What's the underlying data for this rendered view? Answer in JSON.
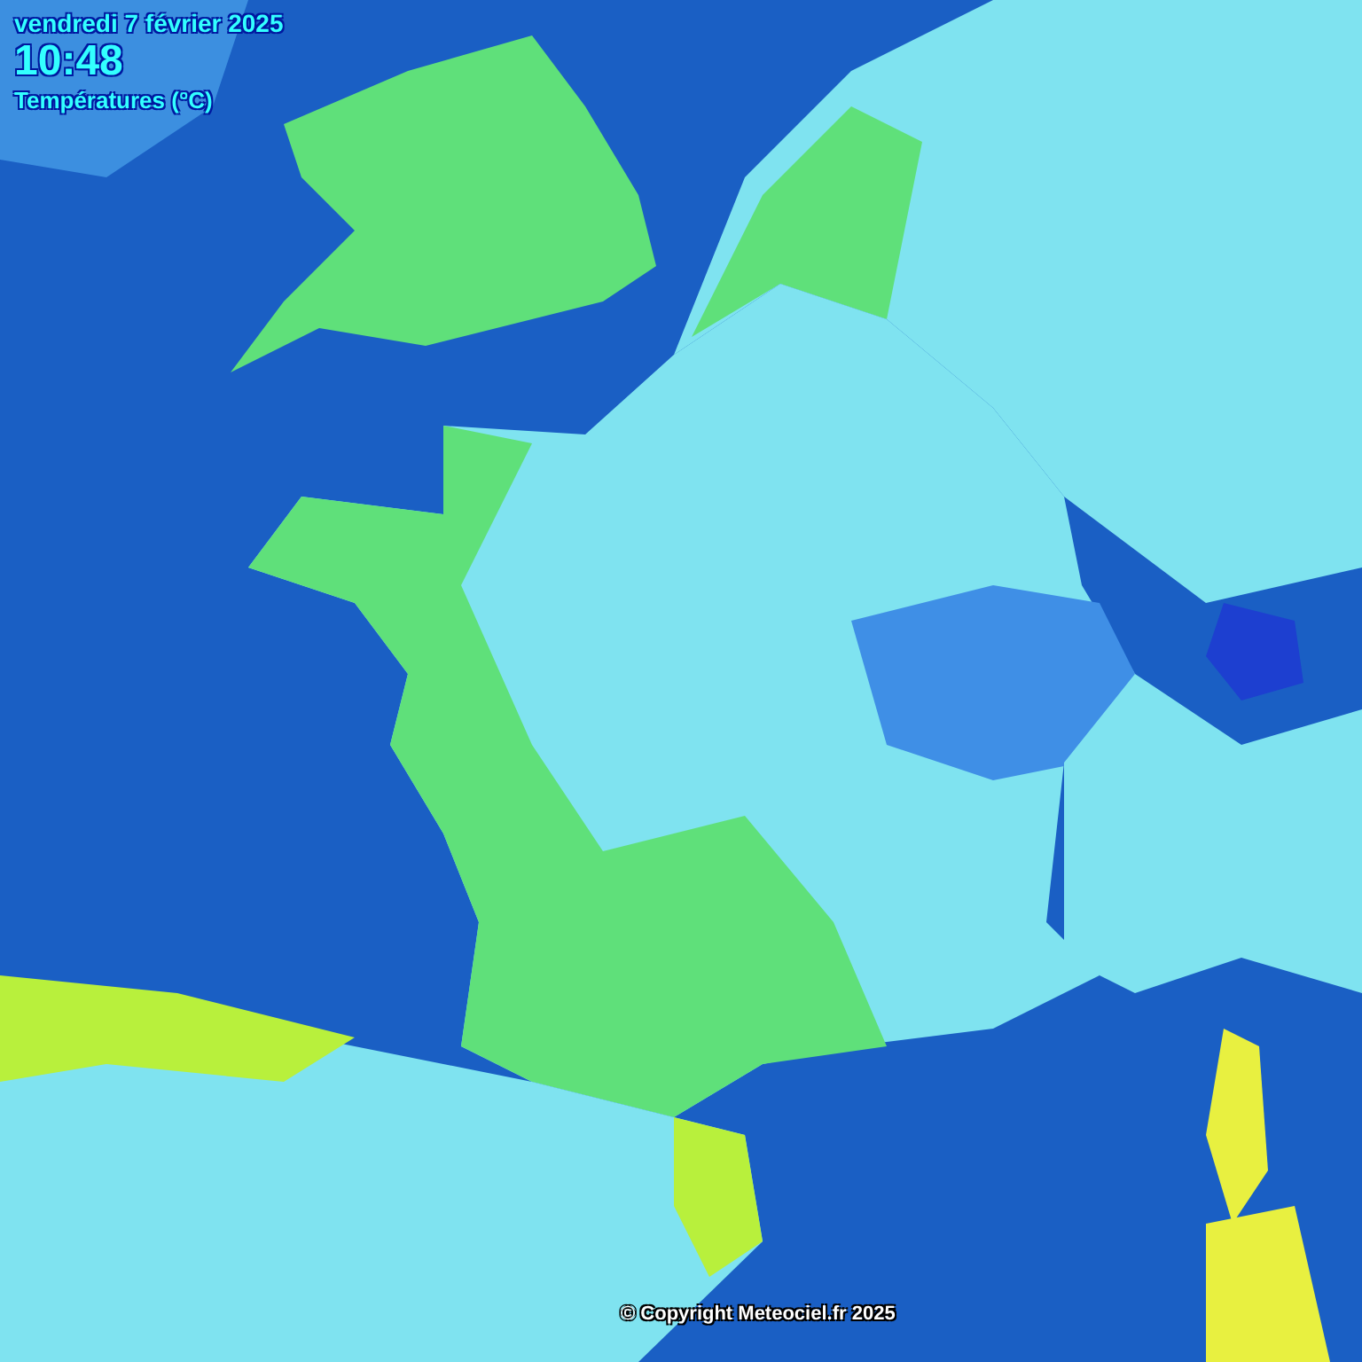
{
  "map": {
    "date": "vendredi 7 février 2025",
    "time": "10:48",
    "legend_title": "Températures (°C)",
    "copyright": "© Copyright Meteociel.fr 2025"
  }
}
